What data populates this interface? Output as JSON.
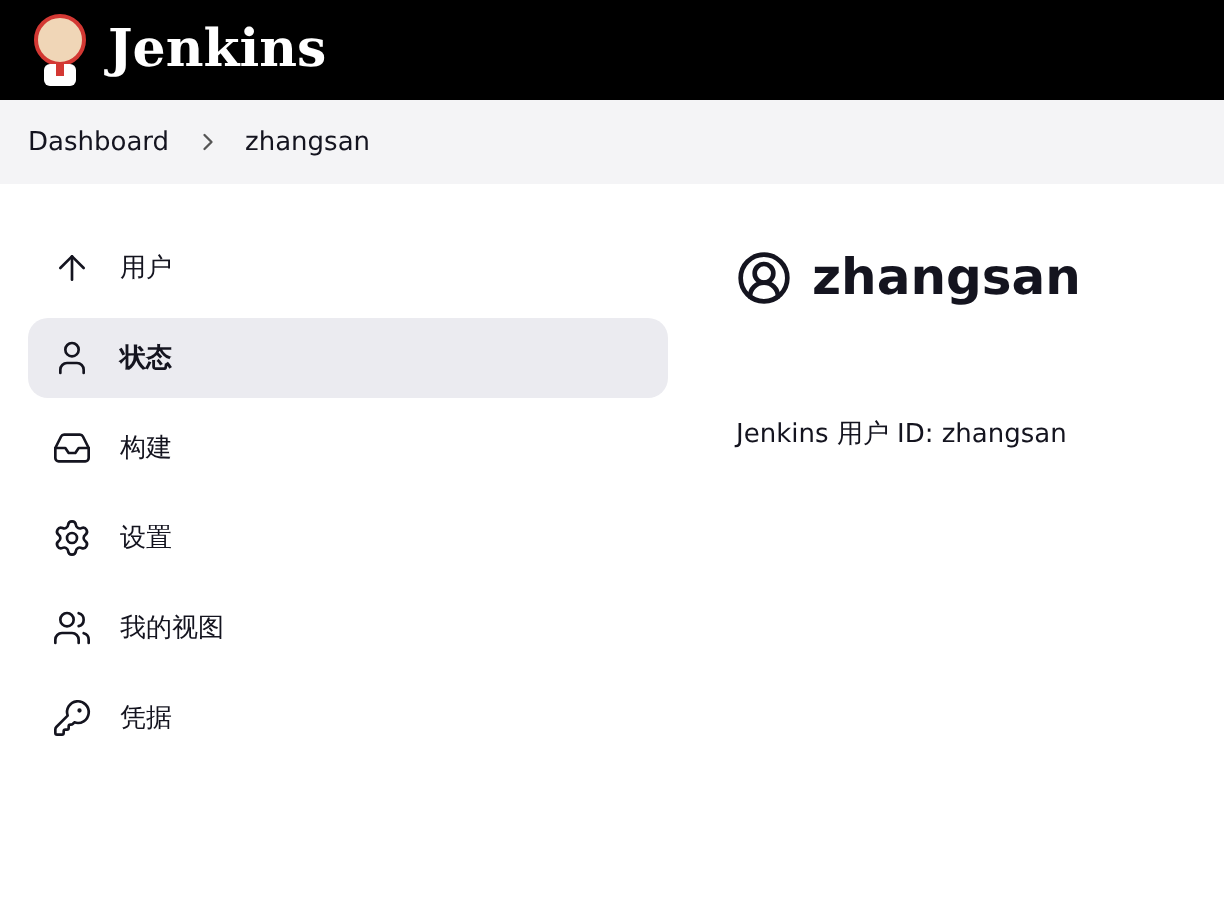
{
  "header": {
    "title": "Jenkins"
  },
  "breadcrumbs": [
    {
      "label": "Dashboard"
    },
    {
      "label": "zhangsan"
    }
  ],
  "sidebar": {
    "items": [
      {
        "label": "用户",
        "selected": false
      },
      {
        "label": "状态",
        "selected": true
      },
      {
        "label": "构建",
        "selected": false
      },
      {
        "label": "设置",
        "selected": false
      },
      {
        "label": "我的视图",
        "selected": false
      },
      {
        "label": "凭据",
        "selected": false
      }
    ]
  },
  "main": {
    "title": "zhangsan",
    "info": "Jenkins 用户 ID: zhangsan"
  }
}
